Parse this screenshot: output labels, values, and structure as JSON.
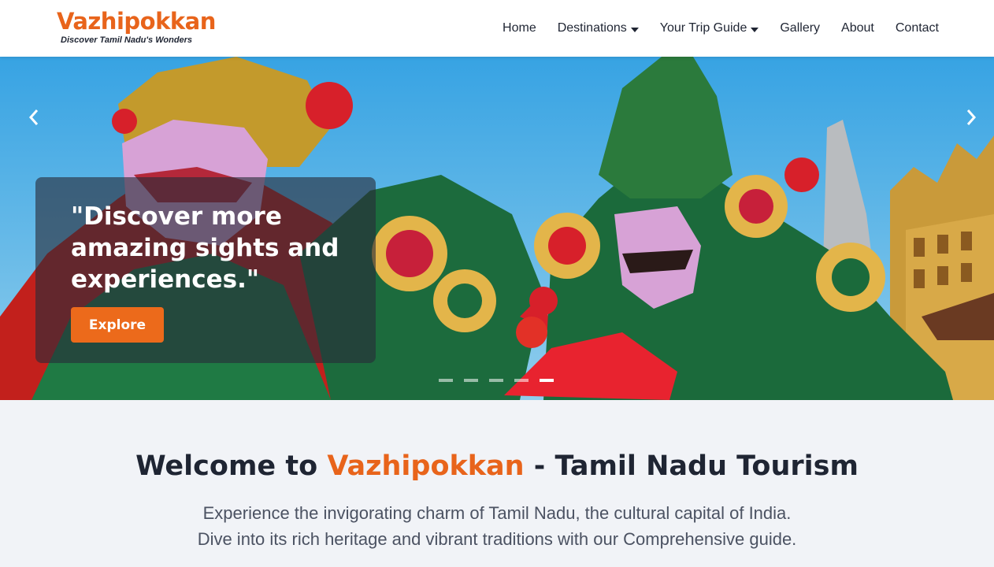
{
  "brand": {
    "name": "Vazhipokkan",
    "tagline": "Discover Tamil Nadu's Wonders",
    "color": "#e8641b"
  },
  "nav": {
    "items": [
      {
        "label": "Home",
        "dropdown": false
      },
      {
        "label": "Destinations",
        "dropdown": true
      },
      {
        "label": "Your Trip Guide",
        "dropdown": true
      },
      {
        "label": "Gallery",
        "dropdown": false
      },
      {
        "label": "About",
        "dropdown": false
      },
      {
        "label": "Contact",
        "dropdown": false
      }
    ]
  },
  "hero": {
    "caption": "\"Discover more amazing sights and experiences.\"",
    "button_label": "Explore",
    "button_color": "#ec6a1b",
    "prev_icon": "chevron-left-icon",
    "next_icon": "chevron-right-icon",
    "slide_count": 5,
    "active_slide": 5
  },
  "welcome": {
    "title_prefix": "Welcome to ",
    "title_accent": "Vazhipokkan",
    "title_suffix": " - Tamil Nadu Tourism",
    "line1": "Experience the invigorating charm of Tamil Nadu, the cultural capital of India.",
    "line2": "Dive into its rich heritage and vibrant traditions with our Comprehensive guide."
  }
}
